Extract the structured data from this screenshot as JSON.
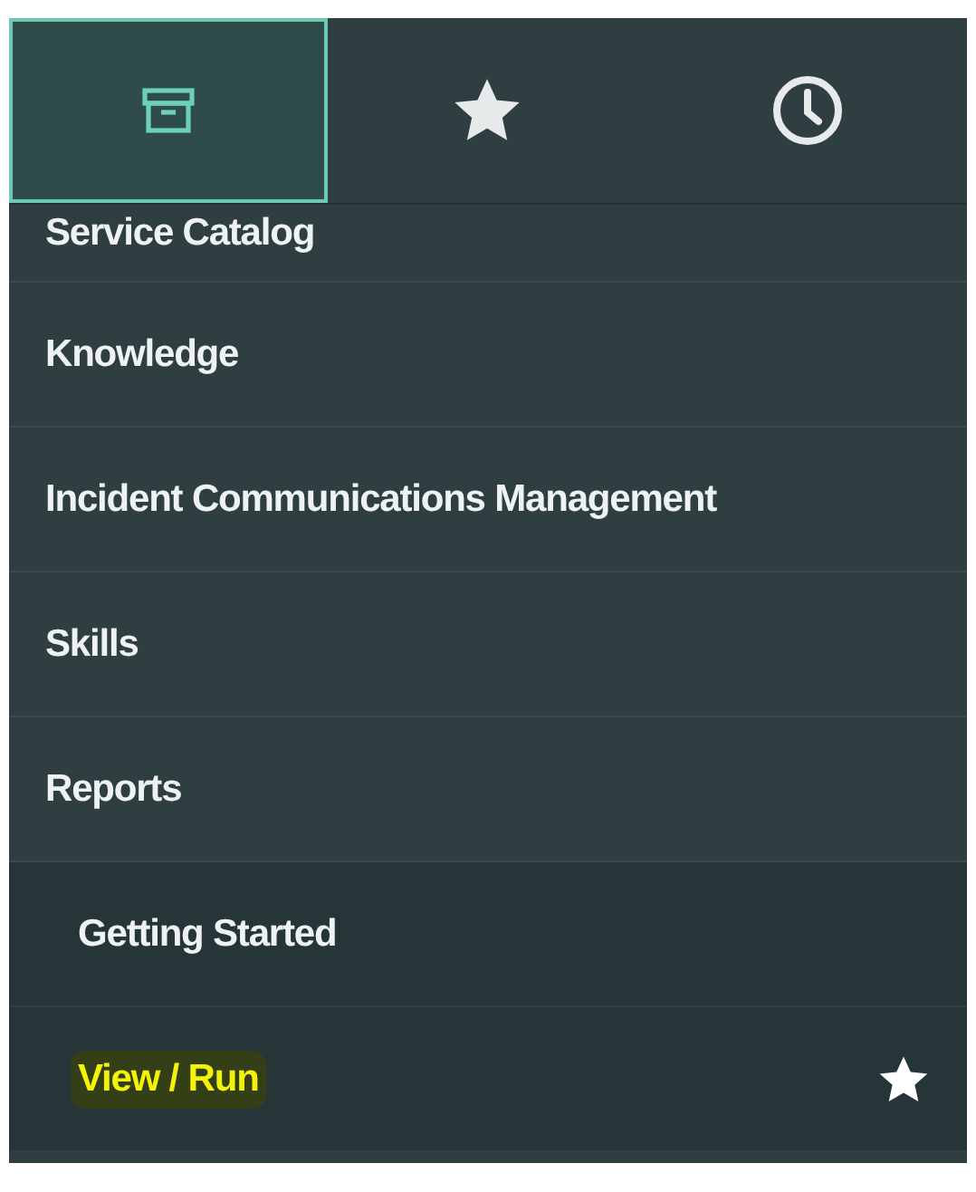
{
  "tabs": [
    {
      "kind": "archive",
      "selected": true
    },
    {
      "kind": "star",
      "selected": false
    },
    {
      "kind": "clock",
      "selected": false
    }
  ],
  "menu": [
    {
      "label": "Service Catalog"
    },
    {
      "label": "Knowledge"
    },
    {
      "label": "Incident Communications Management"
    },
    {
      "label": "Skills"
    },
    {
      "label": "Reports",
      "children": [
        {
          "label": "Getting Started",
          "highlighted": false,
          "starred": false
        },
        {
          "label": "View / Run",
          "highlighted": true,
          "starred": true
        }
      ]
    }
  ]
}
